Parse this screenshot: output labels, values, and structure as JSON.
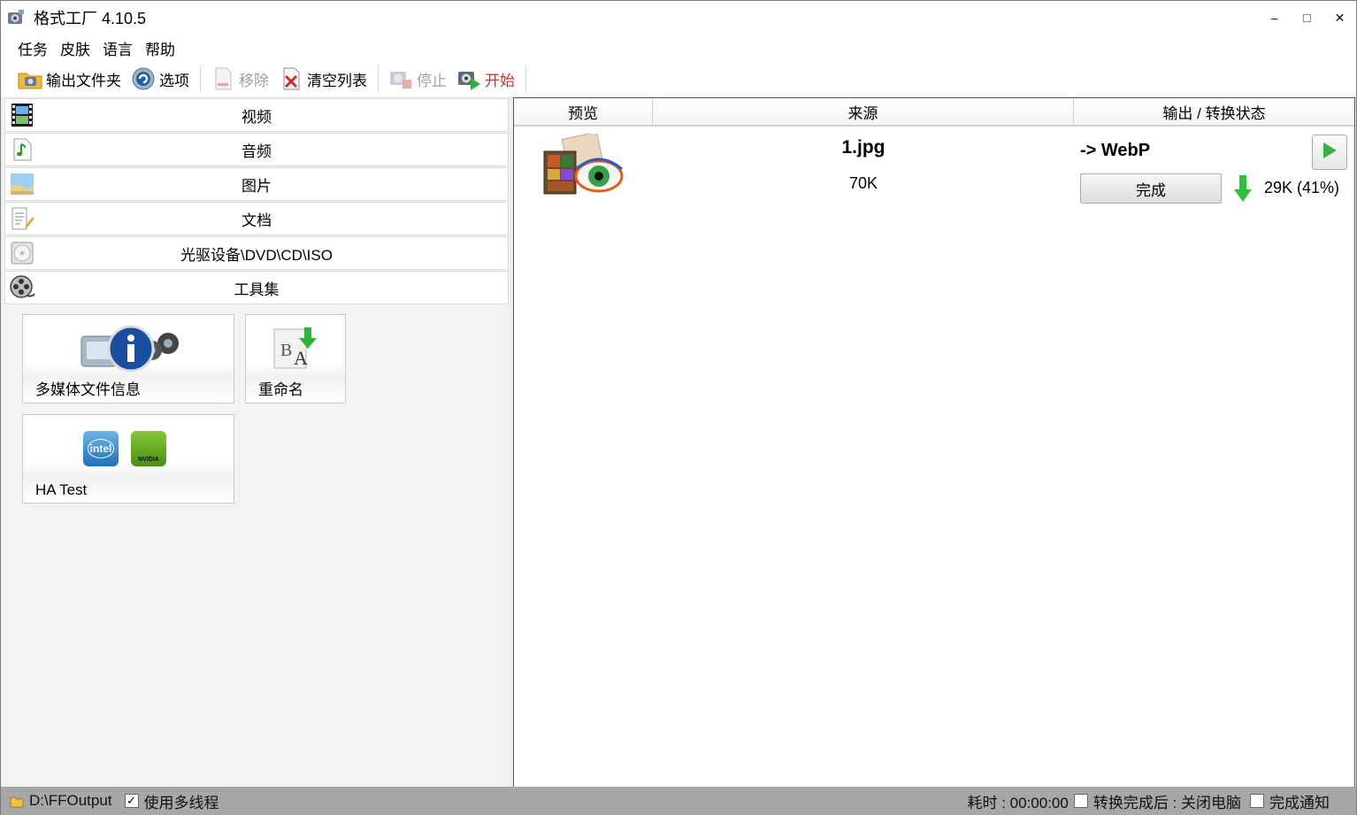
{
  "window": {
    "title": "格式工厂 4.10.5",
    "controls": {
      "minimize": "–",
      "maximize": "□",
      "close": "✕"
    }
  },
  "menu": [
    "任务",
    "皮肤",
    "语言",
    "帮助"
  ],
  "toolbar": {
    "output_folder": "输出文件夹",
    "options": "选项",
    "remove": "移除",
    "clear_list": "清空列表",
    "stop": "停止",
    "start": "开始"
  },
  "categories": [
    "视频",
    "音频",
    "图片",
    "文档",
    "光驱设备\\DVD\\CD\\ISO",
    "工具集"
  ],
  "tools": {
    "media_info": "多媒体文件信息",
    "rename": "重命名",
    "ha_test": "HA Test",
    "intel_logo": "intel",
    "nvidia_logo": "NVIDIA"
  },
  "list": {
    "headers": [
      "预览",
      "来源",
      "输出 / 转换状态"
    ],
    "rows": [
      {
        "source_name": "1.jpg",
        "source_size": "70K",
        "output_format": "-> WebP",
        "status": "完成",
        "output_size": "29K  (41%)"
      }
    ]
  },
  "statusbar": {
    "output_path": "D:\\FFOutput",
    "multithread_label": "使用多线程",
    "multithread_checked": "✓",
    "elapsed": "耗时 : 00:00:00",
    "shutdown_label": "转换完成后 : 关闭电脑",
    "notify_label": "完成通知"
  },
  "colors": {
    "start_text": "#c0392b",
    "play_green": "#3cb043",
    "arrow_green": "#2fbf3a",
    "statusbar_bg": "#a7a7a7"
  }
}
